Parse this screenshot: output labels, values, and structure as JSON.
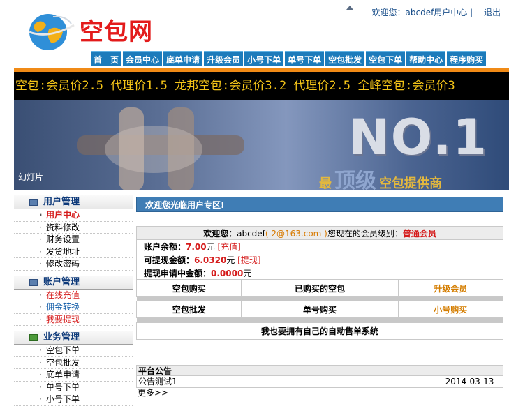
{
  "header": {
    "logo_text": "空包网",
    "welcome": "欢迎您：abcdef",
    "user_center": "用户中心",
    "logout": "退出"
  },
  "nav": {
    "items": [
      "首　页",
      "会员中心",
      "底单申请",
      "升级会员",
      "小号下单",
      "单号下单",
      "空包批发",
      "空包下单",
      "帮助中心",
      "程序购买"
    ]
  },
  "marquee": {
    "text": "空包:会员价2.5 代理价1.5 龙邦空包:会员价3.2 代理价2.5 全峰空包:会员价3"
  },
  "banner": {
    "slide_label": "幻灯片",
    "headline": "NO.1",
    "tagline_prefix": "最",
    "tagline_big": "顶级",
    "tagline_suffix": "空包提供商"
  },
  "sidebar": {
    "groups": [
      {
        "title": "用户管理",
        "items": [
          "用户中心",
          "资料修改",
          "财务设置",
          "发货地址",
          "修改密码"
        ]
      },
      {
        "title": "账户管理",
        "items": [
          "在线充值",
          "佣金转换",
          "我要提现"
        ]
      },
      {
        "title": "业务管理",
        "items": [
          "空包下单",
          "空包批发",
          "底单申请",
          "单号下单",
          "小号下单"
        ]
      }
    ]
  },
  "main": {
    "welcome_title": "欢迎您光临用户专区!",
    "info": {
      "greeting_label": "欢迎您：",
      "username": "abcdef",
      "email": "( 2@163.com )",
      "level_text": "您现在的会员级别：",
      "level_value": "普通会员",
      "balance_label": "账户余额：",
      "balance_value": "7.00",
      "balance_unit": "元",
      "recharge": "[充值]",
      "withdrawable_label": "可提现金额：",
      "withdrawable_value": "6.0320",
      "withdrawable_unit": "元",
      "withdraw": "[提现]",
      "pending_label": "提现申请中金额：",
      "pending_value": "0.0000",
      "pending_unit": "元"
    },
    "actions": {
      "row1": [
        "空包购买",
        "已购买的空包",
        "升级会员"
      ],
      "row2": [
        "空包批发",
        "单号购买",
        "小号购买"
      ]
    },
    "auto_sell": "我也要拥有自己的自动售单系统"
  },
  "notice": {
    "title": "平台公告",
    "items": [
      {
        "title": "公告测试1",
        "date": "2014-03-13"
      }
    ],
    "more": "更多>>"
  },
  "colors": {
    "nav_bg": "#1c7bbb",
    "accent_orange": "#f08a16",
    "marquee_text": "#f5c518",
    "logo_red": "#e31b1b",
    "welcome_bar": "#3f7db5"
  }
}
